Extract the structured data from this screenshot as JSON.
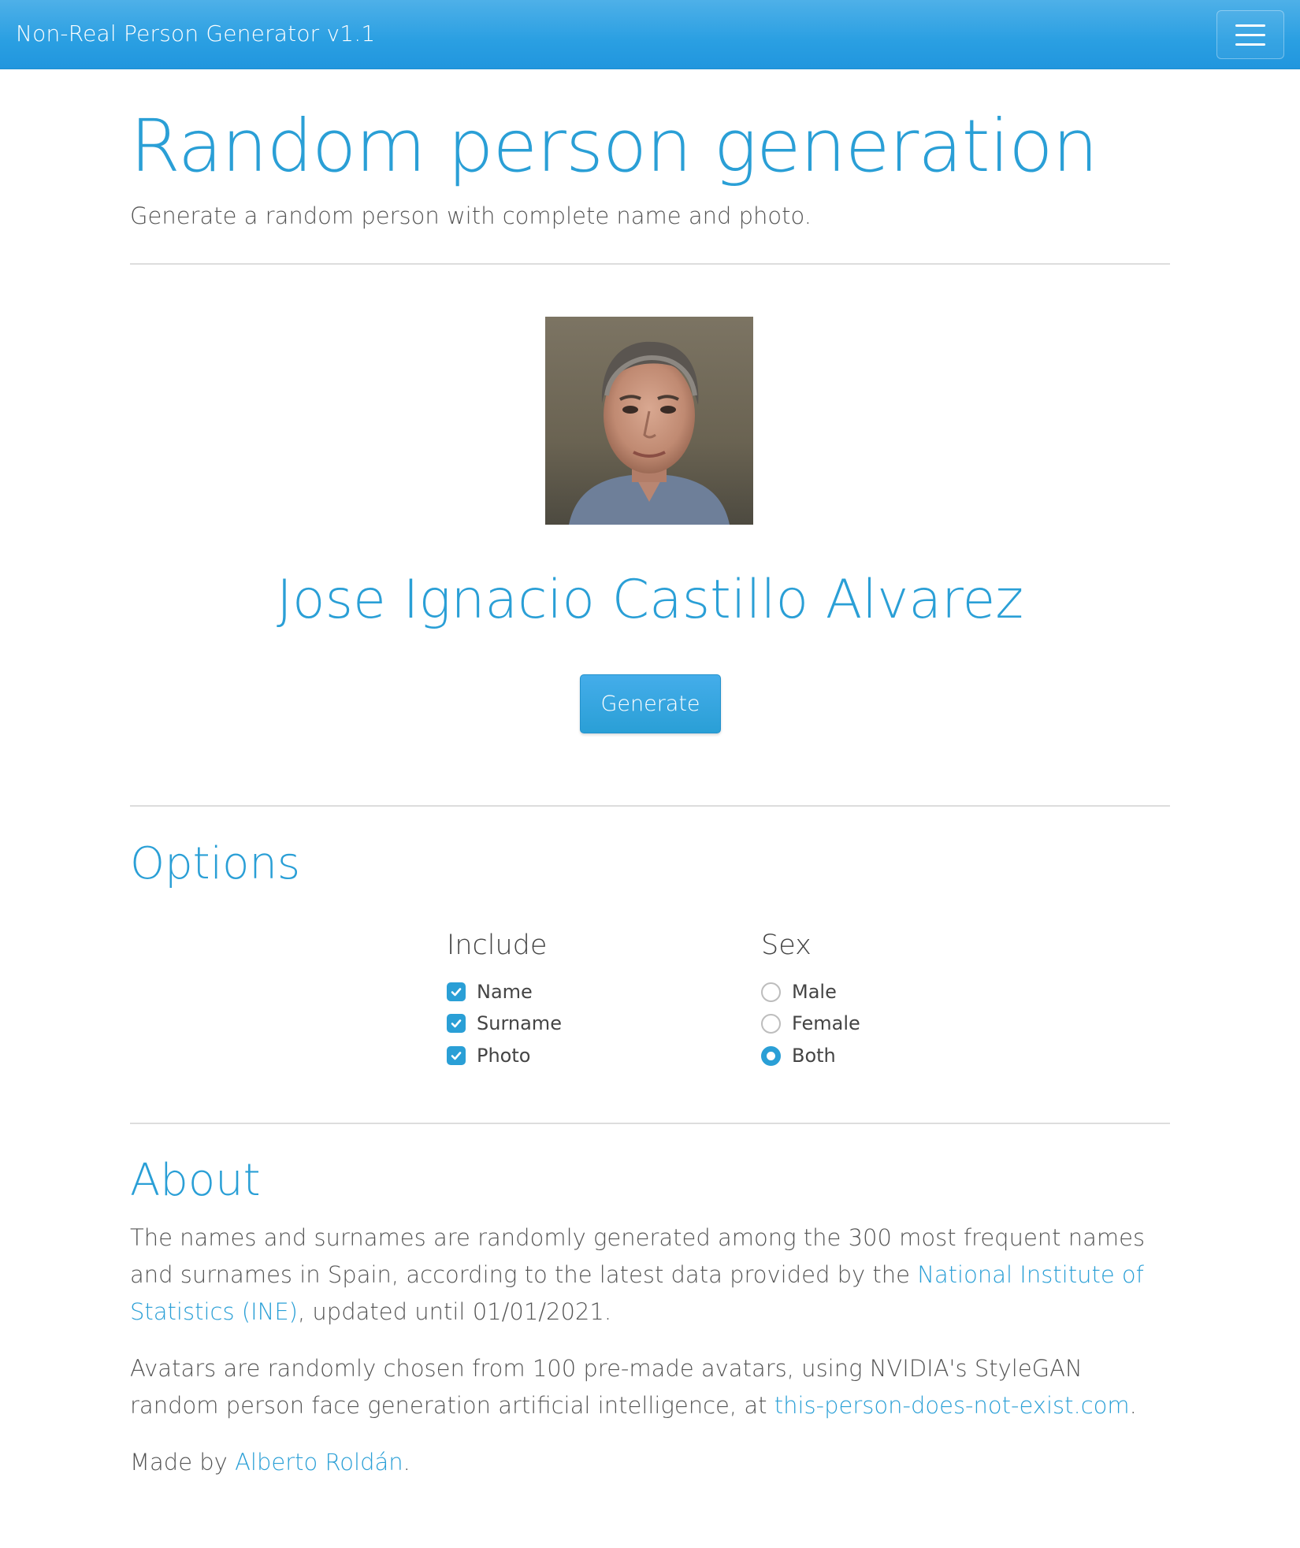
{
  "navbar": {
    "brand": "Non-Real Person Generator v1.1",
    "menu_icon": "hamburger-menu-icon"
  },
  "header": {
    "title": "Random person generation",
    "lead": "Generate a random person with complete name and photo."
  },
  "person": {
    "photo_icon": "avatar-photo",
    "name": "Jose Ignacio Castillo Alvarez",
    "generate_label": "Generate"
  },
  "options": {
    "title": "Options",
    "include": {
      "title": "Include",
      "items": [
        {
          "label": "Name",
          "checked": true
        },
        {
          "label": "Surname",
          "checked": true
        },
        {
          "label": "Photo",
          "checked": true
        }
      ]
    },
    "sex": {
      "title": "Sex",
      "items": [
        {
          "label": "Male",
          "selected": false
        },
        {
          "label": "Female",
          "selected": false
        },
        {
          "label": "Both",
          "selected": true
        }
      ]
    }
  },
  "about": {
    "title": "About",
    "p1_before": "The names and surnames are randomly generated among the 300 most frequent names and surnames in Spain, according to the latest data provided by the ",
    "p1_link": "National Institute of Statistics (INE)",
    "p1_after": ", updated until 01/01/2021.",
    "p2_before": "Avatars are randomly chosen from 100 pre-made avatars, using NVIDIA's StyleGAN random person face generation artificial intelligence, at ",
    "p2_link": "this-person-does-not-exist.com",
    "p2_after": ".",
    "p3_before": "Made by ",
    "p3_link": "Alberto Roldán",
    "p3_after": "."
  },
  "colors": {
    "accent": "#2a9fd6",
    "navbar": "#2a9fe2"
  }
}
